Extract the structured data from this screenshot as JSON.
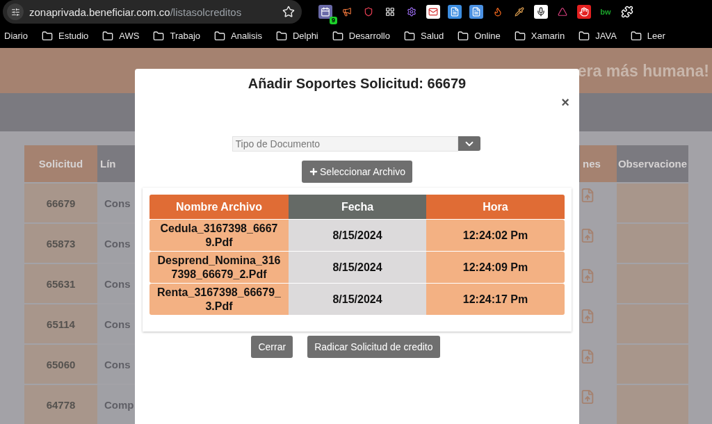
{
  "browser": {
    "url_host": "zonaprivada.beneficiar.com.co",
    "url_path": "/listasolcreditos",
    "extension_badge": "9",
    "extension_text": "bw"
  },
  "bookmarks": [
    {
      "label": "Diario",
      "kind": "link"
    },
    {
      "label": "Estudio",
      "kind": "folder"
    },
    {
      "label": "AWS",
      "kind": "folder"
    },
    {
      "label": "Trabajo",
      "kind": "folder"
    },
    {
      "label": "Analisis",
      "kind": "folder"
    },
    {
      "label": "Delphi",
      "kind": "folder"
    },
    {
      "label": "Desarrollo",
      "kind": "folder"
    },
    {
      "label": "Salud",
      "kind": "folder"
    },
    {
      "label": "Online",
      "kind": "folder"
    },
    {
      "label": "Xamarin",
      "kind": "folder"
    },
    {
      "label": "JAVA",
      "kind": "folder"
    },
    {
      "label": "Leer",
      "kind": "folder"
    }
  ],
  "page": {
    "banner_text": "era más humana!",
    "table": {
      "columns": [
        "Solicitud",
        "Lín",
        "nes",
        "Observacione"
      ],
      "rows": [
        {
          "solicitud": "66679",
          "linea": "Cons"
        },
        {
          "solicitud": "65873",
          "linea": "Cons"
        },
        {
          "solicitud": "65631",
          "linea": "Cons"
        },
        {
          "solicitud": "65114",
          "linea": "Cons"
        },
        {
          "solicitud": "65060",
          "linea": "Cons"
        },
        {
          "solicitud": "64778",
          "linea": "Comp"
        }
      ]
    }
  },
  "modal": {
    "title": "Añadir Soportes Solicitud: 66679",
    "close": "×",
    "document_type": {
      "placeholder": "Tipo de Documento"
    },
    "select_file_button": "Seleccionar Archivo",
    "files": {
      "columns": [
        "Nombre Archivo",
        "Fecha",
        "Hora"
      ],
      "rows": [
        {
          "name": "Cedula_3167398_66679.Pdf",
          "date": "8/15/2024",
          "time": "12:24:02 Pm"
        },
        {
          "name": "Desprend_Nomina_3167398_66679_2.Pdf",
          "date": "8/15/2024",
          "time": "12:24:09 Pm"
        },
        {
          "name": "Renta_3167398_66679_3.Pdf",
          "date": "8/15/2024",
          "time": "12:24:17 Pm"
        }
      ]
    },
    "buttons": [
      "Cerrar",
      "Radicar Solicitud de credito"
    ]
  }
}
